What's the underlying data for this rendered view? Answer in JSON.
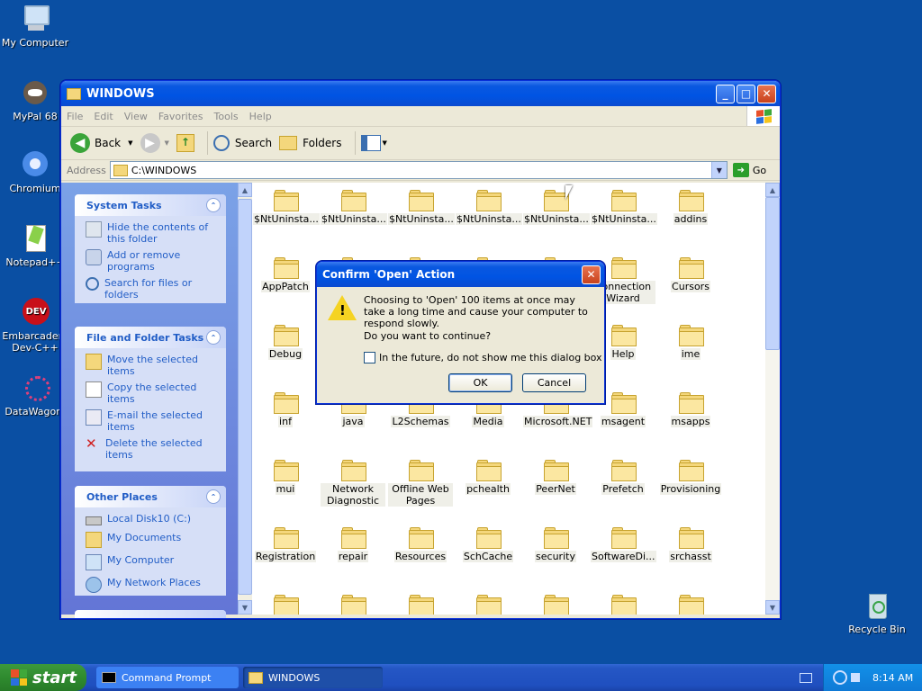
{
  "desktop": {
    "icons": [
      {
        "label": "My Computer",
        "icon": "my-computer-icon"
      },
      {
        "label": "MyPal 68",
        "icon": "mypal-icon"
      },
      {
        "label": "Chromium",
        "icon": "chromium-icon"
      },
      {
        "label": "Notepad++",
        "icon": "notepadpp-icon"
      },
      {
        "label": "Embarcadero Dev-C++",
        "icon": "devcpp-icon"
      },
      {
        "label": "DataWagon.",
        "icon": "datawagon-icon"
      },
      {
        "label": "Recycle Bin",
        "icon": "recycle-bin-icon"
      }
    ]
  },
  "window": {
    "title": "WINDOWS",
    "menu": [
      "File",
      "Edit",
      "View",
      "Favorites",
      "Tools",
      "Help"
    ],
    "toolbar": {
      "back": "Back",
      "search": "Search",
      "folders": "Folders"
    },
    "address": {
      "label": "Address",
      "value": "C:\\WINDOWS",
      "go": "Go"
    },
    "panels": {
      "system_tasks": {
        "title": "System Tasks",
        "items": [
          "Hide the contents of this folder",
          "Add or remove programs",
          "Search for files or folders"
        ]
      },
      "file_folder_tasks": {
        "title": "File and Folder Tasks",
        "items": [
          "Move the selected items",
          "Copy the selected items",
          "E-mail the selected items",
          "Delete the selected items"
        ]
      },
      "other_places": {
        "title": "Other Places",
        "items": [
          "Local Disk10 (C:)",
          "My Documents",
          "My Computer",
          "My Network Places"
        ]
      }
    },
    "folders": [
      "$NtUninsta...",
      "$NtUninsta...",
      "$NtUninsta...",
      "$NtUninsta...",
      "$NtUninsta...",
      "$NtUninsta...",
      "addins",
      "AppPatch",
      "",
      "",
      "",
      "",
      "Connection Wizard",
      "Cursors",
      "Debug",
      "",
      "",
      "",
      "",
      "Help",
      "ime",
      "inf",
      "java",
      "L2Schemas",
      "Media",
      "Microsoft.NET",
      "msagent",
      "msapps",
      "mui",
      "Network Diagnostic",
      "Offline Web Pages",
      "pchealth",
      "PeerNet",
      "Prefetch",
      "Provisioning",
      "Registration",
      "repair",
      "Resources",
      "SchCache",
      "security",
      "SoftwareDi...",
      "srchasst",
      "",
      "",
      "",
      "",
      "",
      "",
      ""
    ]
  },
  "dialog": {
    "title": "Confirm 'Open' Action",
    "message": "Choosing to 'Open' 100 items at once may take a long time and cause your computer to respond slowly.",
    "question": "Do you want to continue?",
    "checkbox": "In the future, do not show me this dialog box",
    "ok": "OK",
    "cancel": "Cancel"
  },
  "taskbar": {
    "start": "start",
    "items": [
      "Command Prompt",
      "WINDOWS"
    ],
    "clock": "8:14 AM"
  }
}
